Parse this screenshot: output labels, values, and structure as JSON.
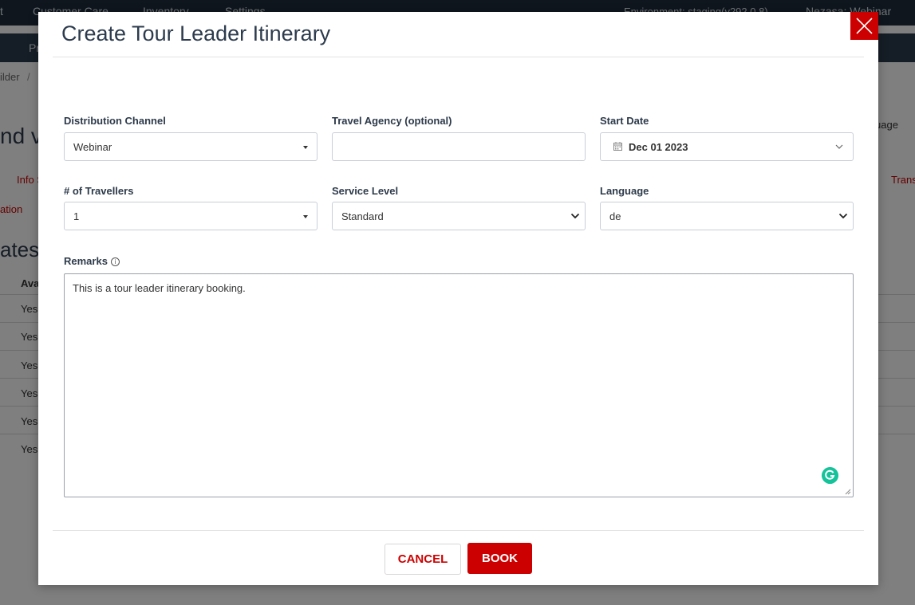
{
  "background": {
    "nav_items": [
      "t",
      "Customer Care",
      "Inventory",
      "Settings"
    ],
    "environment": "Environment: staging(v292.0.8)",
    "user": "Nezasa: Webinar",
    "subnav_item": "Pr",
    "breadcrumb": "ilder",
    "breadcrumb_sep": "/",
    "heading_fragment": "nd v",
    "language_fragment": "uage",
    "info_tab": "Info S",
    "trans_tab": "Trans",
    "ation_tab": "ation",
    "section_heading": "ates",
    "column_header": "Ava",
    "rows": [
      "Yes",
      "Yes",
      "Yes",
      "Yes",
      "Yes",
      "Yes"
    ]
  },
  "modal": {
    "title": "Create Tour Leader Itinerary",
    "close_icon": "close-icon",
    "fields": {
      "distribution_channel": {
        "label": "Distribution Channel",
        "value": "Webinar"
      },
      "travel_agency": {
        "label": "Travel Agency (optional)",
        "value": "",
        "placeholder": ""
      },
      "start_date": {
        "label": "Start Date",
        "value": "Dec 01 2023"
      },
      "travellers": {
        "label": "# of Travellers",
        "value": "1"
      },
      "service_level": {
        "label": "Service Level",
        "value": "Standard",
        "options": [
          "Standard"
        ]
      },
      "language": {
        "label": "Language",
        "value": "de",
        "options": [
          "de"
        ]
      },
      "remarks": {
        "label": "Remarks",
        "info_glyph": "i",
        "value": "This is a tour leader itinerary booking."
      }
    },
    "buttons": {
      "cancel": "CANCEL",
      "book": "BOOK"
    }
  },
  "colors": {
    "accent": "#cc0000",
    "title": "#2c3b4d",
    "nav": "#1f2d3d",
    "grammarly": "#15c39a"
  }
}
